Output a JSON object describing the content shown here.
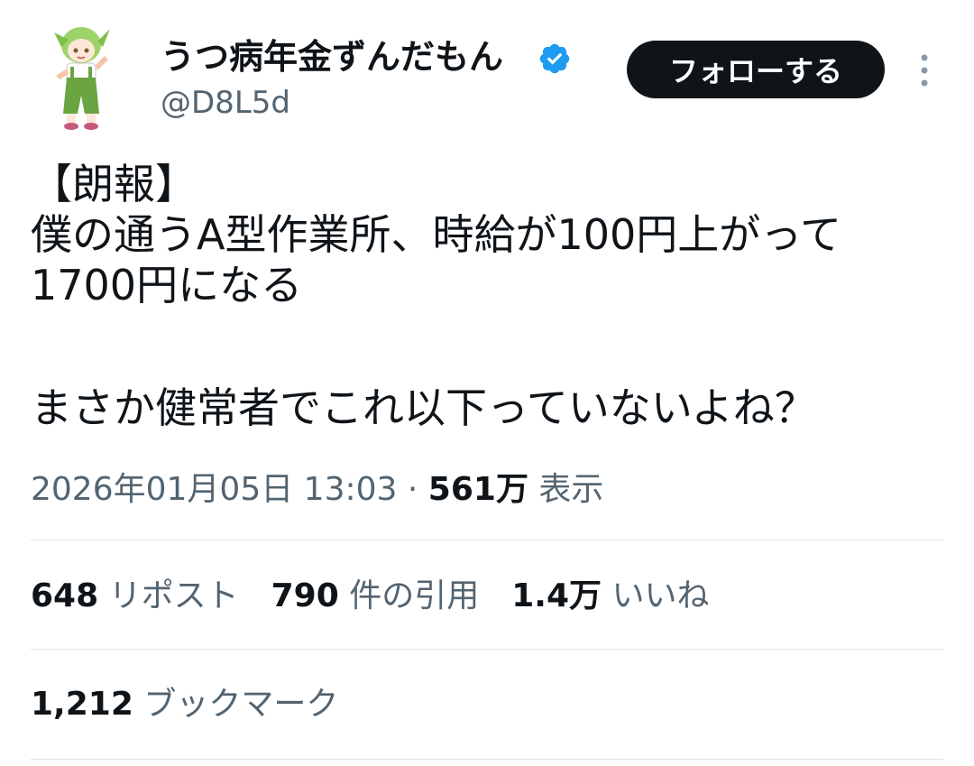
{
  "author": {
    "display_name": "うつ病年金ずんだもん",
    "handle": "@D8L5d",
    "verified_icon": "verified-badge-icon",
    "avatar_icon": "zundamon-character-avatar"
  },
  "follow_button": {
    "label": "フォローする"
  },
  "more_icon": "more-vertical-icon",
  "tweet": {
    "lines": [
      "【朗報】",
      "僕の通うA型作業所、時給が100円上がって",
      "1700円になる",
      "",
      "まさか健常者でこれ以下っていないよね？"
    ]
  },
  "meta": {
    "timestamp": "2026年01月05日 13:03",
    "separator": "·",
    "views_count": "561万",
    "views_label": "表示"
  },
  "stats": {
    "reposts": {
      "count": "648",
      "label": "リポスト"
    },
    "quotes": {
      "count": "790",
      "label": "件の引用"
    },
    "likes": {
      "count": "1.4万",
      "label": "いいね"
    },
    "bookmarks": {
      "count": "1,212",
      "label": "ブックマーク"
    }
  },
  "colors": {
    "text_primary": "#0f1419",
    "text_secondary": "#536471",
    "verified_blue": "#1d9bf0",
    "divider": "#dfe3e6",
    "button_bg": "#0f1419",
    "button_text": "#ffffff"
  }
}
